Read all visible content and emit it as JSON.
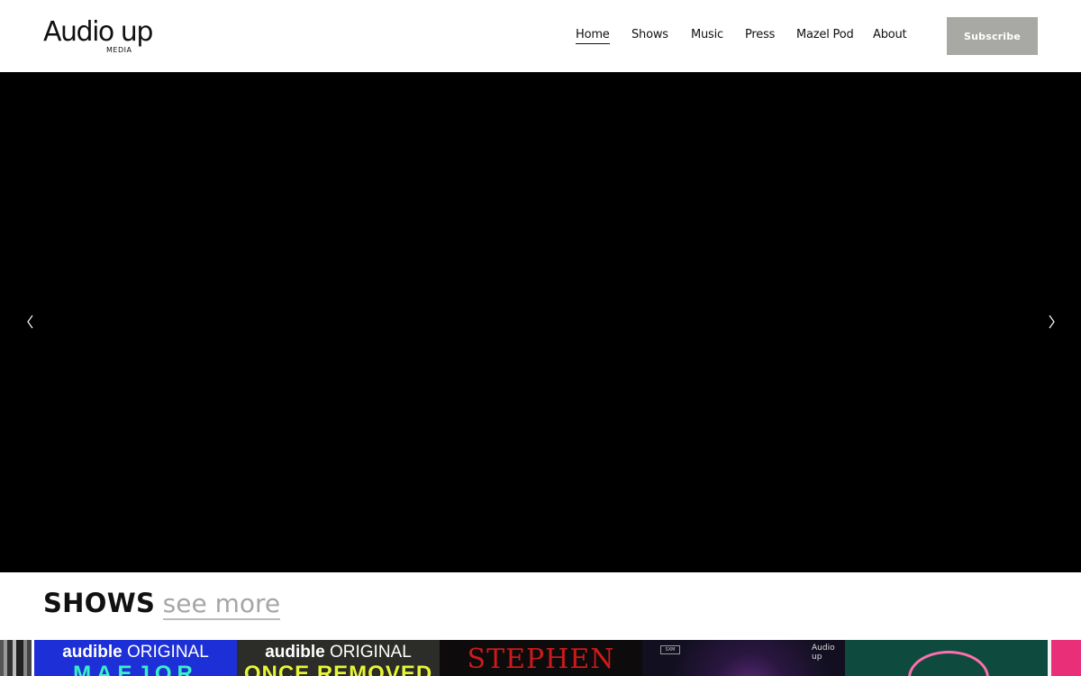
{
  "header": {
    "logo": {
      "wordmark": "Audio up",
      "sub": "MEDIA"
    },
    "nav": [
      {
        "label": "Home",
        "active": true
      },
      {
        "label": "Shows",
        "active": false
      },
      {
        "label": "Music",
        "active": false
      },
      {
        "label": "Press",
        "active": false
      },
      {
        "label": "Mazel Pod",
        "active": false
      },
      {
        "label": "About",
        "active": false
      }
    ],
    "subscribe_label": "Subscribe"
  },
  "hero": {
    "background": "#000000",
    "prev_icon": "chevron-left-icon",
    "next_icon": "chevron-right-icon"
  },
  "shows": {
    "title": "SHOWS",
    "see_more": "see more",
    "tiles": [
      {
        "line1_bold": "audible",
        "line1": "ORIGINAL",
        "line2": "MAEJOR"
      },
      {
        "line1_bold": "audible",
        "line1": "ORIGINAL",
        "line2": "ONCE REMOVED"
      },
      {
        "line1": "STEPHEN"
      },
      {
        "badge": "SXM",
        "brand": "Audio up"
      },
      {}
    ]
  },
  "colors": {
    "accent": "#a8a8a4",
    "link_muted": "#a6a6a6",
    "text": "#111111"
  }
}
